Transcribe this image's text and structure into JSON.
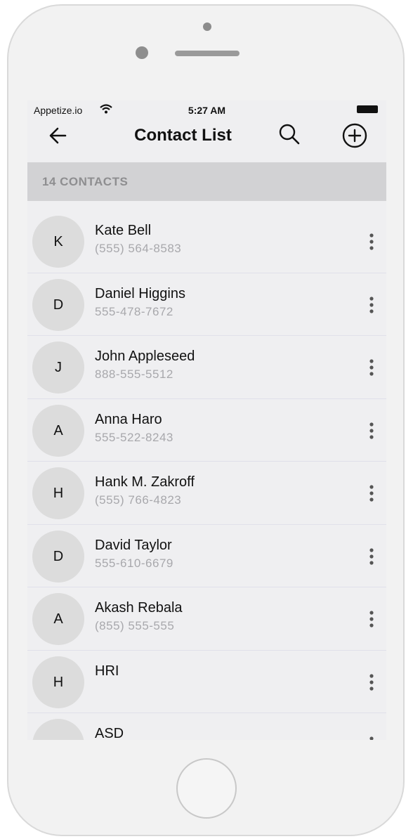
{
  "status_bar": {
    "carrier": "Appetize.io",
    "time": "5:27 AM"
  },
  "header": {
    "title": "Contact List"
  },
  "section": {
    "count_label": "14 CONTACTS"
  },
  "contacts": [
    {
      "initial": "K",
      "name": "Kate Bell",
      "phone": "(555) 564-8583"
    },
    {
      "initial": "D",
      "name": "Daniel Higgins",
      "phone": "555-478-7672"
    },
    {
      "initial": "J",
      "name": "John Appleseed",
      "phone": "888-555-5512"
    },
    {
      "initial": "A",
      "name": "Anna Haro",
      "phone": "555-522-8243"
    },
    {
      "initial": "H",
      "name": "Hank M. Zakroff",
      "phone": "(555) 766-4823"
    },
    {
      "initial": "D",
      "name": "David Taylor",
      "phone": "555-610-6679"
    },
    {
      "initial": "A",
      "name": "Akash Rebala",
      "phone": "(855) 555-555"
    },
    {
      "initial": "H",
      "name": "HRI",
      "phone": ""
    },
    {
      "initial": "",
      "name": "ASD",
      "phone": ""
    }
  ],
  "icons": {
    "back": "arrow-left-icon",
    "search": "search-icon",
    "add": "plus-circle-icon",
    "more": "more-vertical-icon",
    "wifi": "wifi-icon",
    "battery": "battery-icon"
  }
}
